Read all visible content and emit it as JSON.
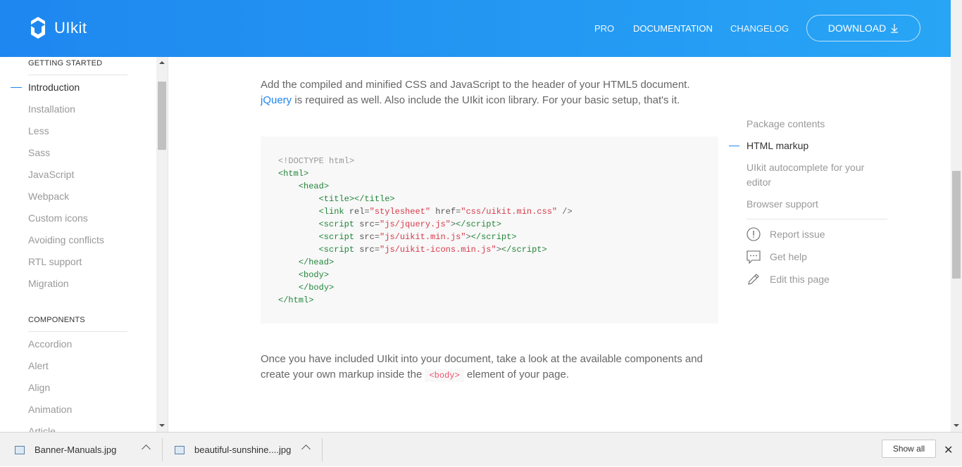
{
  "header": {
    "logo_text": "UIkit",
    "nav": {
      "pro": "PRO",
      "documentation": "DOCUMENTATION",
      "changelog": "CHANGELOG"
    },
    "download_label": "DOWNLOAD"
  },
  "sidebar": {
    "getting_started_heading": "GETTING STARTED",
    "getting_started": [
      "Introduction",
      "Installation",
      "Less",
      "Sass",
      "JavaScript",
      "Webpack",
      "Custom icons",
      "Avoiding conflicts",
      "RTL support",
      "Migration"
    ],
    "components_heading": "COMPONENTS",
    "components": [
      "Accordion",
      "Alert",
      "Align",
      "Animation",
      "Article"
    ]
  },
  "main": {
    "intro_text": "Add the compiled and minified CSS and JavaScript to the header of your HTML5 document.",
    "jquery_link": "jQuery",
    "intro_text_2": "is required as well. Also include the UIkit icon library. For your basic setup, that's it.",
    "outro_text_1": "Once you have included UIkit into your document, take a look at the available components and create your own markup inside the",
    "outro_code": "<body>",
    "outro_text_2": "element of your page."
  },
  "code_sample": {
    "doctype": "<!DOCTYPE html>",
    "stylesheet_href": "css/uikit.min.css",
    "scripts": [
      "js/jquery.js",
      "js/uikit.min.js",
      "js/uikit-icons.min.js"
    ]
  },
  "toc": {
    "items": [
      "Package contents",
      "HTML markup",
      "UIkit autocomplete for your editor",
      "Browser support"
    ],
    "active": "HTML markup",
    "actions": [
      {
        "label": "Report issue",
        "icon": "warning-icon"
      },
      {
        "label": "Get help",
        "icon": "comment-icon"
      },
      {
        "label": "Edit this page",
        "icon": "pencil-icon"
      }
    ]
  },
  "download_bar": {
    "files": [
      "Banner-Manuals.jpg",
      "beautiful-sunshine....jpg"
    ],
    "show_all": "Show all"
  }
}
